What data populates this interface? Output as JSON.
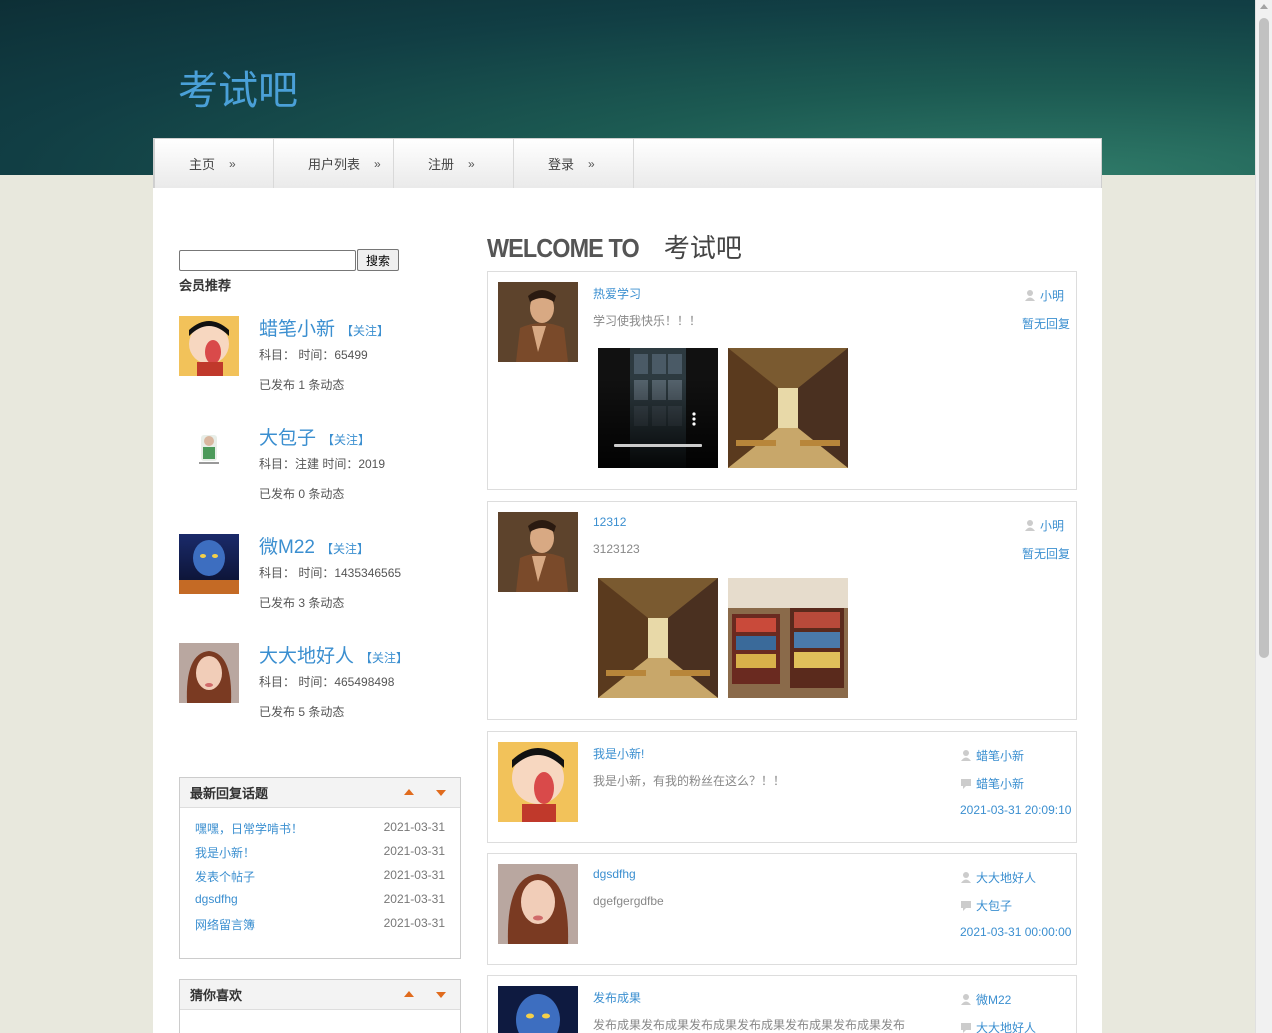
{
  "site": {
    "title": "考试吧"
  },
  "nav": [
    {
      "label": "主页",
      "arrow": "»"
    },
    {
      "label": "用户列表",
      "arrow": "»"
    },
    {
      "label": "注册",
      "arrow": "»"
    },
    {
      "label": "登录",
      "arrow": "»"
    }
  ],
  "search": {
    "value": "",
    "placeholder": "",
    "button": "搜索"
  },
  "members": {
    "heading": "会员推荐",
    "items": [
      {
        "name": "蜡笔小新",
        "follow": "【关注】",
        "subject": "科目： 时间：65499",
        "posts": "已发布 1 条动态"
      },
      {
        "name": "大包子",
        "follow": "【关注】",
        "subject": "科目：注建 时间：2019",
        "posts": "已发布 0 条动态"
      },
      {
        "name": "微M22",
        "follow": "【关注】",
        "subject": "科目： 时间：1435346565",
        "posts": "已发布 3 条动态"
      },
      {
        "name": "大大地好人",
        "follow": "【关注】",
        "subject": "科目： 时间：465498498",
        "posts": "已发布 5 条动态"
      }
    ]
  },
  "recent_topics": {
    "title": "最新回复话题",
    "items": [
      {
        "title": "嘿嘿，日常学啃书！",
        "date": "2021-03-31"
      },
      {
        "title": "我是小新！",
        "date": "2021-03-31"
      },
      {
        "title": "发表个帖子",
        "date": "2021-03-31"
      },
      {
        "title": "dgsdfhg",
        "date": "2021-03-31"
      },
      {
        "title": "网络留言簿",
        "date": "2021-03-31"
      }
    ]
  },
  "guess": {
    "title": "猜你喜欢"
  },
  "welcome": {
    "prefix": "WELCOME TO",
    "name": "考试吧"
  },
  "posts": [
    {
      "title": "热爱学习",
      "content": "学习使我快乐！！！",
      "author": "小明",
      "reply": "暂无回复"
    },
    {
      "title": "12312",
      "content": "3123123",
      "author": "小明",
      "reply": "暂无回复"
    },
    {
      "title": "我是小新!",
      "content": "我是小新，有我的粉丝在这么？！！",
      "author": "蜡笔小新",
      "replier": "蜡笔小新",
      "date": "2021-03-31 20:09:10"
    },
    {
      "title": "dgsdfhg",
      "content": "dgefgergdfbe",
      "author": "大大地好人",
      "replier": "大包子",
      "date": "2021-03-31 00:00:00"
    },
    {
      "title": "发布成果",
      "content": "发布成果发布成果发布成果发布成果发布成果发布成果发布",
      "author": "微M22",
      "replier": "大大地好人"
    }
  ]
}
